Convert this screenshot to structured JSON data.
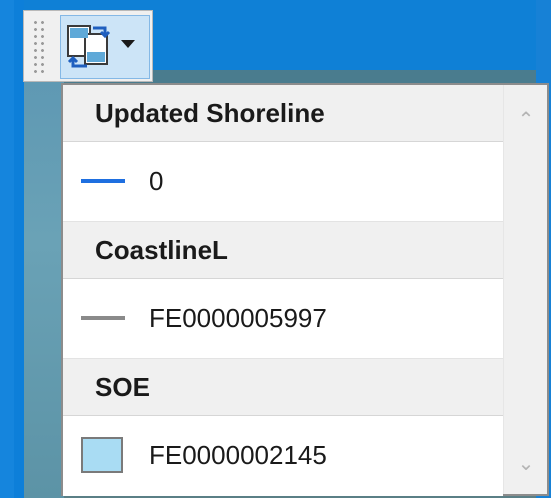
{
  "toolbar": {
    "tool_icon": "swap-layers-icon",
    "dropdown_icon": "chevron-down-icon"
  },
  "legend": {
    "groups": [
      {
        "title": "Updated Shoreline",
        "items": [
          {
            "label": "0",
            "swatch": "line",
            "color": "#1e6fe0"
          }
        ]
      },
      {
        "title": "CoastlineL",
        "items": [
          {
            "label": "FE0000005997",
            "swatch": "line",
            "color": "#8a8a8a"
          }
        ]
      },
      {
        "title": "SOE",
        "items": [
          {
            "label": "FE0000002145",
            "swatch": "fill",
            "color": "#a9dcf3"
          }
        ]
      }
    ]
  },
  "scrollbar": {
    "up_icon": "scroll-up-icon",
    "down_icon": "scroll-down-icon"
  }
}
